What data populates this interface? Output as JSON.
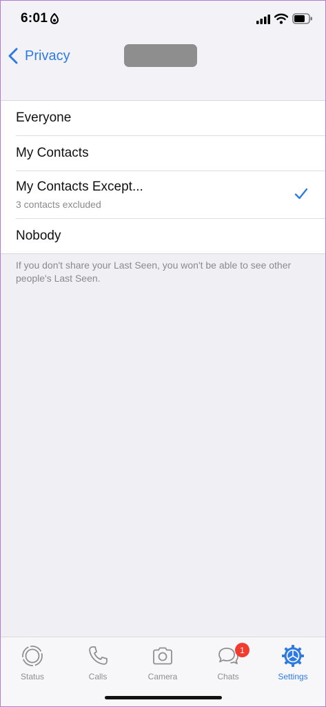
{
  "status_bar": {
    "time": "6:01",
    "icons": [
      "location-icon",
      "cellular-signal-icon",
      "wifi-icon",
      "battery-icon"
    ]
  },
  "nav": {
    "back_label": "Privacy",
    "back_icon": "chevron-left-icon",
    "title_redacted": true
  },
  "options": [
    {
      "label": "Everyone",
      "sublabel": "",
      "selected": false
    },
    {
      "label": "My Contacts",
      "sublabel": "",
      "selected": false
    },
    {
      "label": "My Contacts Except...",
      "sublabel": "3 contacts excluded",
      "selected": true
    },
    {
      "label": "Nobody",
      "sublabel": "",
      "selected": false
    }
  ],
  "footer_note": "If you don't share your Last Seen, you won't be able to see other people's Last Seen.",
  "tabs": [
    {
      "label": "Status",
      "icon": "status-icon",
      "active": false
    },
    {
      "label": "Calls",
      "icon": "phone-icon",
      "active": false
    },
    {
      "label": "Camera",
      "icon": "camera-icon",
      "active": false
    },
    {
      "label": "Chats",
      "icon": "chats-icon",
      "active": false,
      "badge": "1"
    },
    {
      "label": "Settings",
      "icon": "settings-gear-icon",
      "active": true
    }
  ],
  "colors": {
    "accent": "#2f7ae0",
    "badge": "#f23b2f",
    "background": "#efeff4"
  }
}
